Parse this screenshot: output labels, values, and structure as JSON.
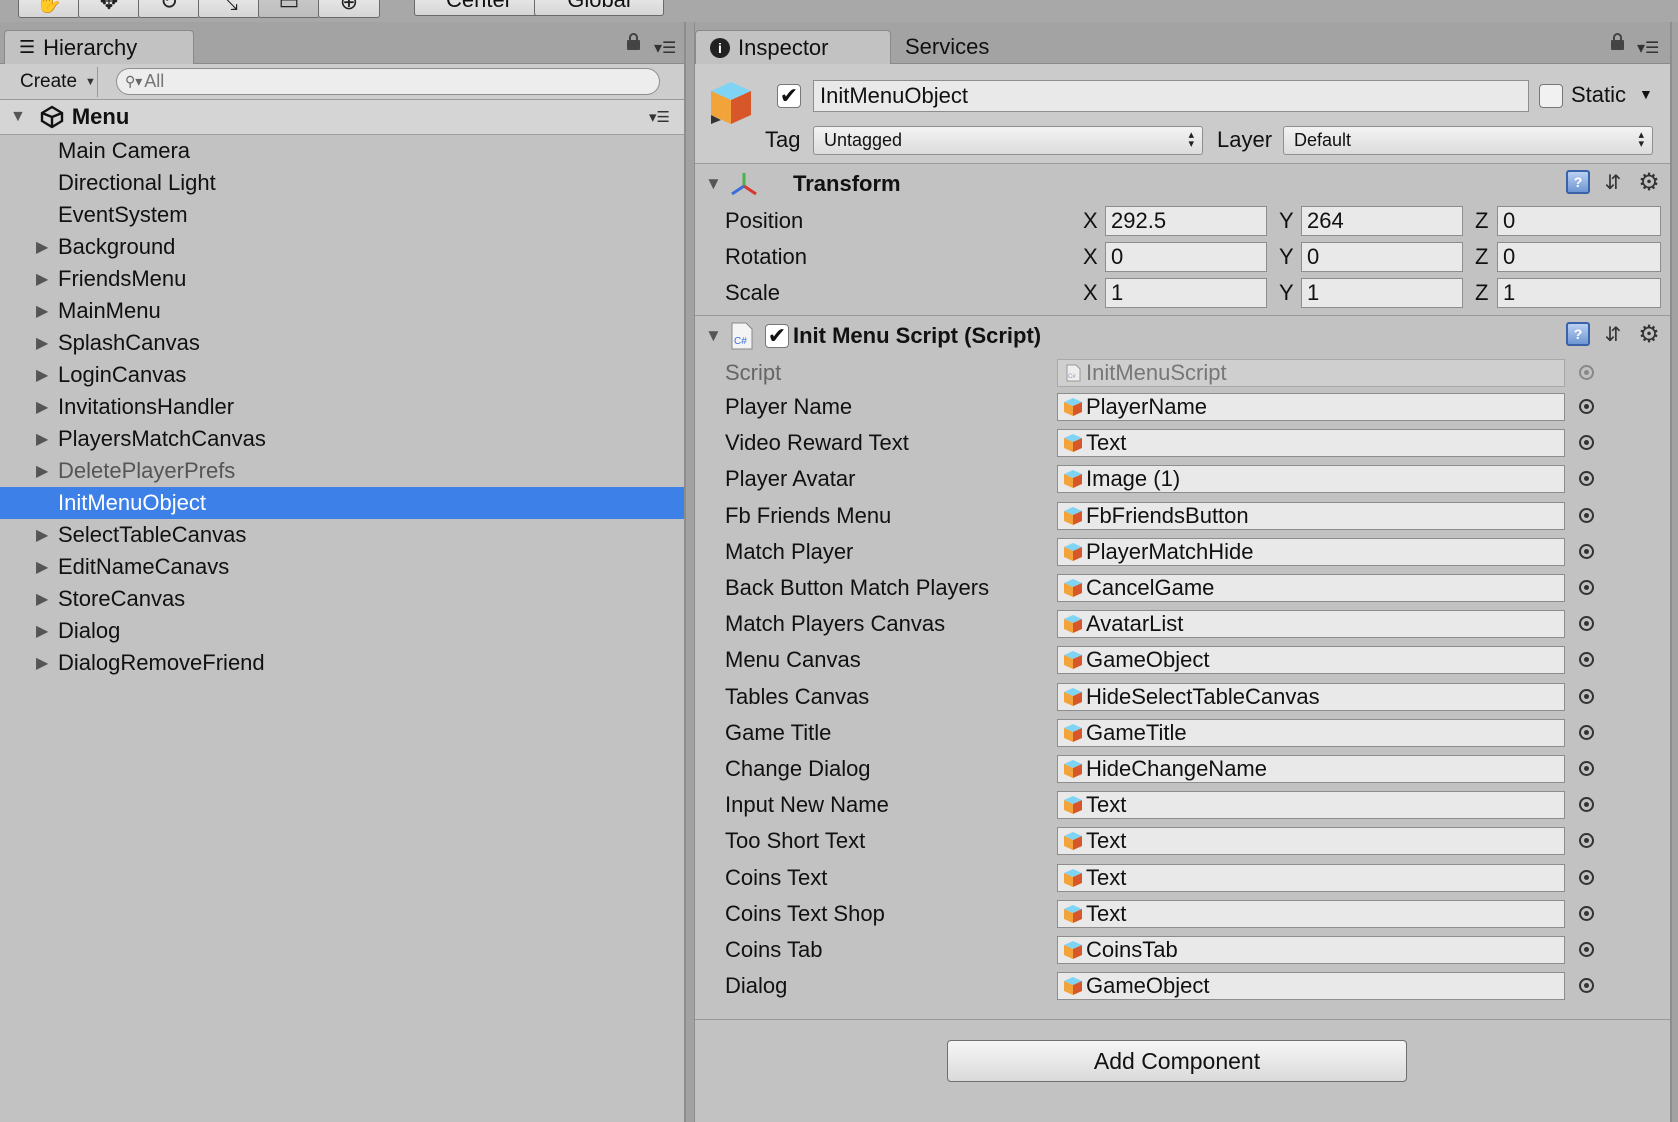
{
  "hierarchy": {
    "tab_label": "Hierarchy",
    "create_label": "Create",
    "search_placeholder": "All",
    "scene_name": "Menu",
    "items": [
      {
        "label": "Main Camera",
        "expandable": false
      },
      {
        "label": "Directional Light",
        "expandable": false
      },
      {
        "label": "EventSystem",
        "expandable": false
      },
      {
        "label": "Background",
        "expandable": true
      },
      {
        "label": "FriendsMenu",
        "expandable": true
      },
      {
        "label": "MainMenu",
        "expandable": true
      },
      {
        "label": "SplashCanvas",
        "expandable": true
      },
      {
        "label": "LoginCanvas",
        "expandable": true
      },
      {
        "label": "InvitationsHandler",
        "expandable": true
      },
      {
        "label": "PlayersMatchCanvas",
        "expandable": true
      },
      {
        "label": "DeletePlayerPrefs",
        "expandable": true,
        "inactive": true
      },
      {
        "label": "InitMenuObject",
        "expandable": false,
        "selected": true
      },
      {
        "label": "SelectTableCanvas",
        "expandable": true
      },
      {
        "label": "EditNameCanavs",
        "expandable": true
      },
      {
        "label": "StoreCanvas",
        "expandable": true
      },
      {
        "label": "Dialog",
        "expandable": true
      },
      {
        "label": "DialogRemoveFriend",
        "expandable": true
      }
    ]
  },
  "toolbar": {
    "pivot_label": "Center",
    "space_label": "Global"
  },
  "inspector": {
    "tab_label": "Inspector",
    "services_tab_label": "Services",
    "object_name": "InitMenuObject",
    "active": true,
    "static_label": "Static",
    "static_checked": false,
    "tag_label": "Tag",
    "tag_value": "Untagged",
    "layer_label": "Layer",
    "layer_value": "Default",
    "transform": {
      "title": "Transform",
      "axis_x": "X",
      "axis_y": "Y",
      "axis_z": "Z",
      "rows": [
        {
          "label": "Position",
          "x": "292.5",
          "y": "264",
          "z": "0"
        },
        {
          "label": "Rotation",
          "x": "0",
          "y": "0",
          "z": "0"
        },
        {
          "label": "Scale",
          "x": "1",
          "y": "1",
          "z": "1"
        }
      ]
    },
    "script_component": {
      "title": "Init Menu Script (Script)",
      "enabled": true,
      "script_label": "Script",
      "script_value": "InitMenuScript",
      "fields": [
        {
          "label": "Player Name",
          "value": "PlayerName"
        },
        {
          "label": "Video Reward Text",
          "value": "Text"
        },
        {
          "label": "Player Avatar",
          "value": "Image (1)"
        },
        {
          "label": "Fb Friends Menu",
          "value": "FbFriendsButton"
        },
        {
          "label": "Match Player",
          "value": "PlayerMatchHide"
        },
        {
          "label": "Back Button Match Players",
          "value": "CancelGame"
        },
        {
          "label": "Match Players Canvas",
          "value": "AvatarList"
        },
        {
          "label": "Menu Canvas",
          "value": "GameObject"
        },
        {
          "label": "Tables Canvas",
          "value": "HideSelectTableCanvas"
        },
        {
          "label": "Game Title",
          "value": "GameTitle"
        },
        {
          "label": "Change Dialog",
          "value": "HideChangeName"
        },
        {
          "label": "Input New Name",
          "value": "Text"
        },
        {
          "label": "Too Short Text",
          "value": "Text"
        },
        {
          "label": "Coins Text",
          "value": "Text"
        },
        {
          "label": "Coins Text Shop",
          "value": "Text"
        },
        {
          "label": "Coins Tab",
          "value": "CoinsTab"
        },
        {
          "label": "Dialog",
          "value": "GameObject"
        }
      ]
    },
    "add_component_label": "Add Component"
  },
  "colors": {
    "selection": "#3d81e8",
    "panel_bg": "#c2c2c2",
    "tab_bg": "#a3a3a3"
  }
}
